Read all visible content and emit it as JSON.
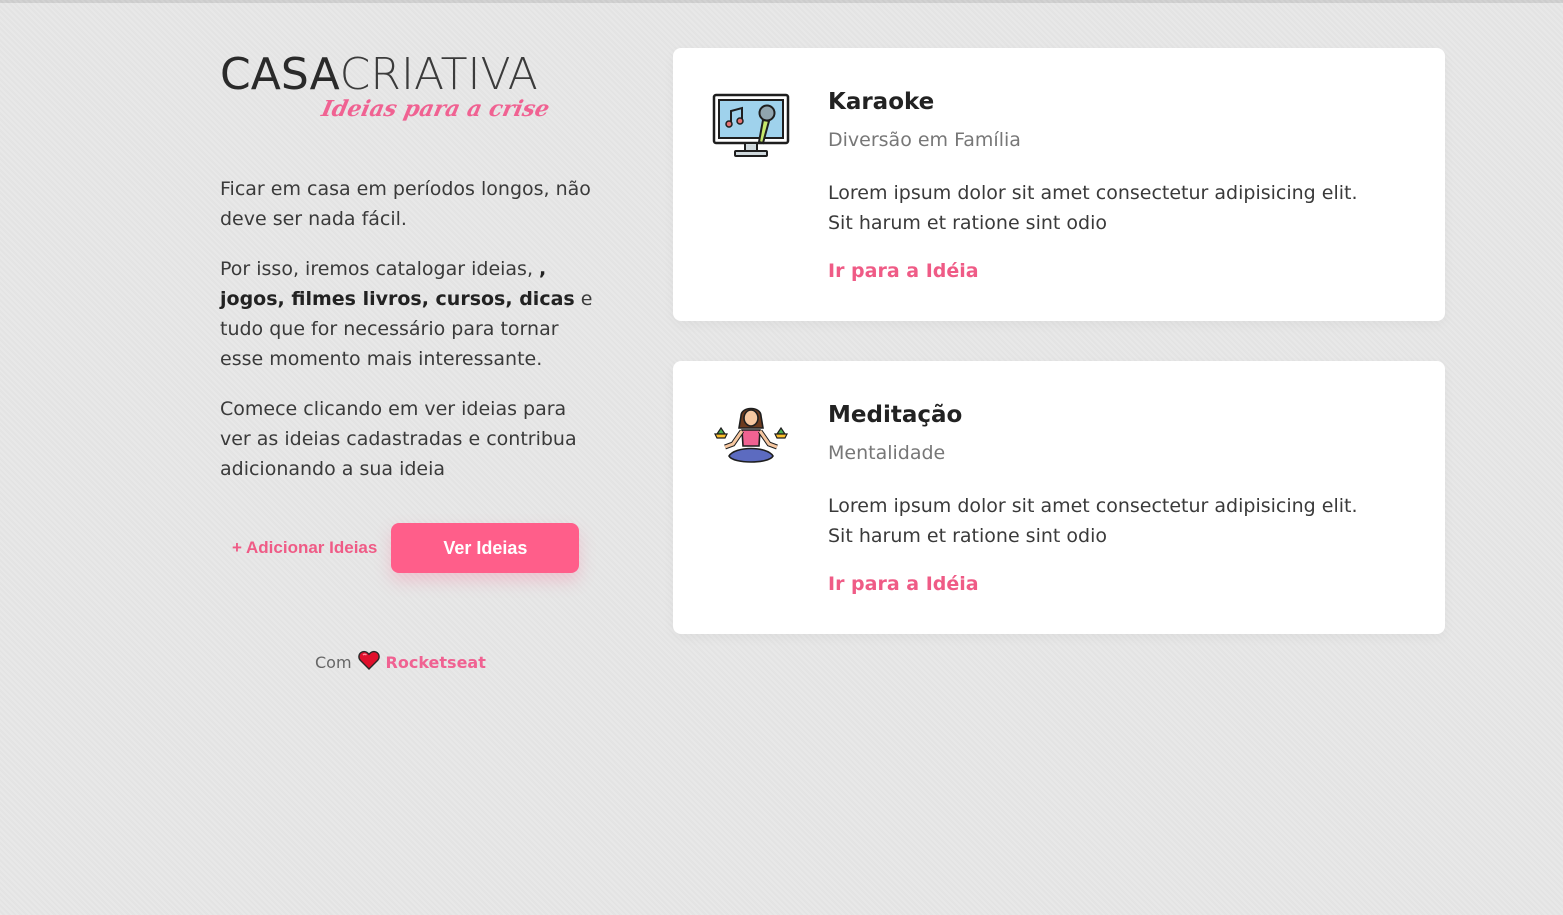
{
  "logo": {
    "word_bold": "CASA",
    "word_thin": "CRIATIVA",
    "tagline": "Ideias para a crise"
  },
  "intro": {
    "p1": "Ficar em casa em períodos longos, não deve ser nada fácil.",
    "p2_start": "Por isso, iremos catalogar ideias, ",
    "p2_bold": ", jogos, filmes livros, cursos, dicas",
    "p2_end": " e tudo que for necessário para tornar esse momento mais interessante.",
    "p3": "Comece clicando em ver ideias para ver as ideias cadastradas e contribua adicionando a sua ideia"
  },
  "actions": {
    "add_label": "+ Adicionar Ideias",
    "view_label": "Ver Ideias"
  },
  "footer": {
    "prefix": "Com",
    "heart_icon": "heart-icon",
    "brand": "Rocketseat"
  },
  "ideas": [
    {
      "title": "Karaoke",
      "category": "Diversão em Família",
      "description": "Lorem ipsum dolor sit amet consectetur adipisicing elit. Sit harum et ratione sint odio",
      "link": "Ir para a Idéia",
      "icon": "karaoke-monitor-icon"
    },
    {
      "title": "Meditação",
      "category": "Mentalidade",
      "description": "Lorem ipsum dolor sit amet consectetur adipisicing elit. Sit harum et ratione sint odio",
      "link": "Ir para a Idéia",
      "icon": "meditation-icon"
    }
  ],
  "colors": {
    "accent": "#ff5e8a",
    "link": "#ef5b86",
    "background": "#e7e7e7"
  }
}
